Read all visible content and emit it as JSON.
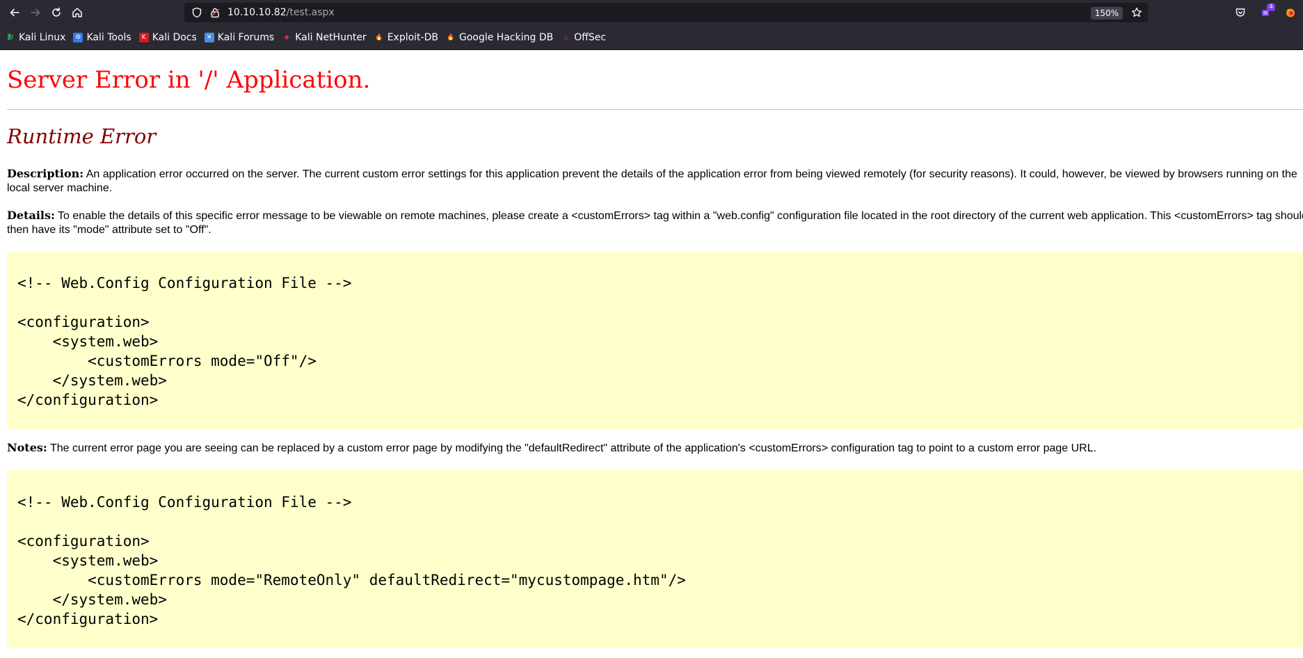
{
  "browser": {
    "url_host": "10.10.10.82",
    "url_path": "/test.aspx",
    "zoom": "150%",
    "extension_badge": "4",
    "bookmarks": [
      {
        "label": "Kali Linux",
        "icon": "kali-dragon-icon"
      },
      {
        "label": "Kali Tools",
        "icon": "kali-tools-icon"
      },
      {
        "label": "Kali Docs",
        "icon": "kali-docs-icon"
      },
      {
        "label": "Kali Forums",
        "icon": "kali-forums-icon"
      },
      {
        "label": "Kali NetHunter",
        "icon": "nethunter-icon"
      },
      {
        "label": "Exploit-DB",
        "icon": "exploit-db-icon"
      },
      {
        "label": "Google Hacking DB",
        "icon": "ghdb-icon"
      },
      {
        "label": "OffSec",
        "icon": "offsec-icon"
      }
    ]
  },
  "page": {
    "title": "Server Error in '/' Application.",
    "subtitle": "Runtime Error",
    "description_label": "Description:",
    "description_text": " An application error occurred on the server. The current custom error settings for this application prevent the details of the application error from being viewed remotely (for security reasons). It could, however, be viewed by browsers running on the local server machine.",
    "details_label": "Details:",
    "details_text": " To enable the details of this specific error message to be viewable on remote machines, please create a <customErrors> tag within a \"web.config\" configuration file located in the root directory of the current web application. This <customErrors> tag should then have its \"mode\" attribute set to \"Off\".",
    "code1": "\n<!-- Web.Config Configuration File -->\n\n<configuration>\n    <system.web>\n        <customErrors mode=\"Off\"/>\n    </system.web>\n</configuration>",
    "notes_label": "Notes:",
    "notes_text": " The current error page you are seeing can be replaced by a custom error page by modifying the \"defaultRedirect\" attribute of the application's <customErrors> configuration tag to point to a custom error page URL.",
    "code2": "\n<!-- Web.Config Configuration File -->\n\n<configuration>\n    <system.web>\n        <customErrors mode=\"RemoteOnly\" defaultRedirect=\"mycustompage.htm\"/>\n    </system.web>\n</configuration>"
  },
  "colors": {
    "title": "#ff0000",
    "subtitle": "#800000",
    "code_bg": "#ffffcc",
    "chrome_bg": "#2b2a33"
  }
}
